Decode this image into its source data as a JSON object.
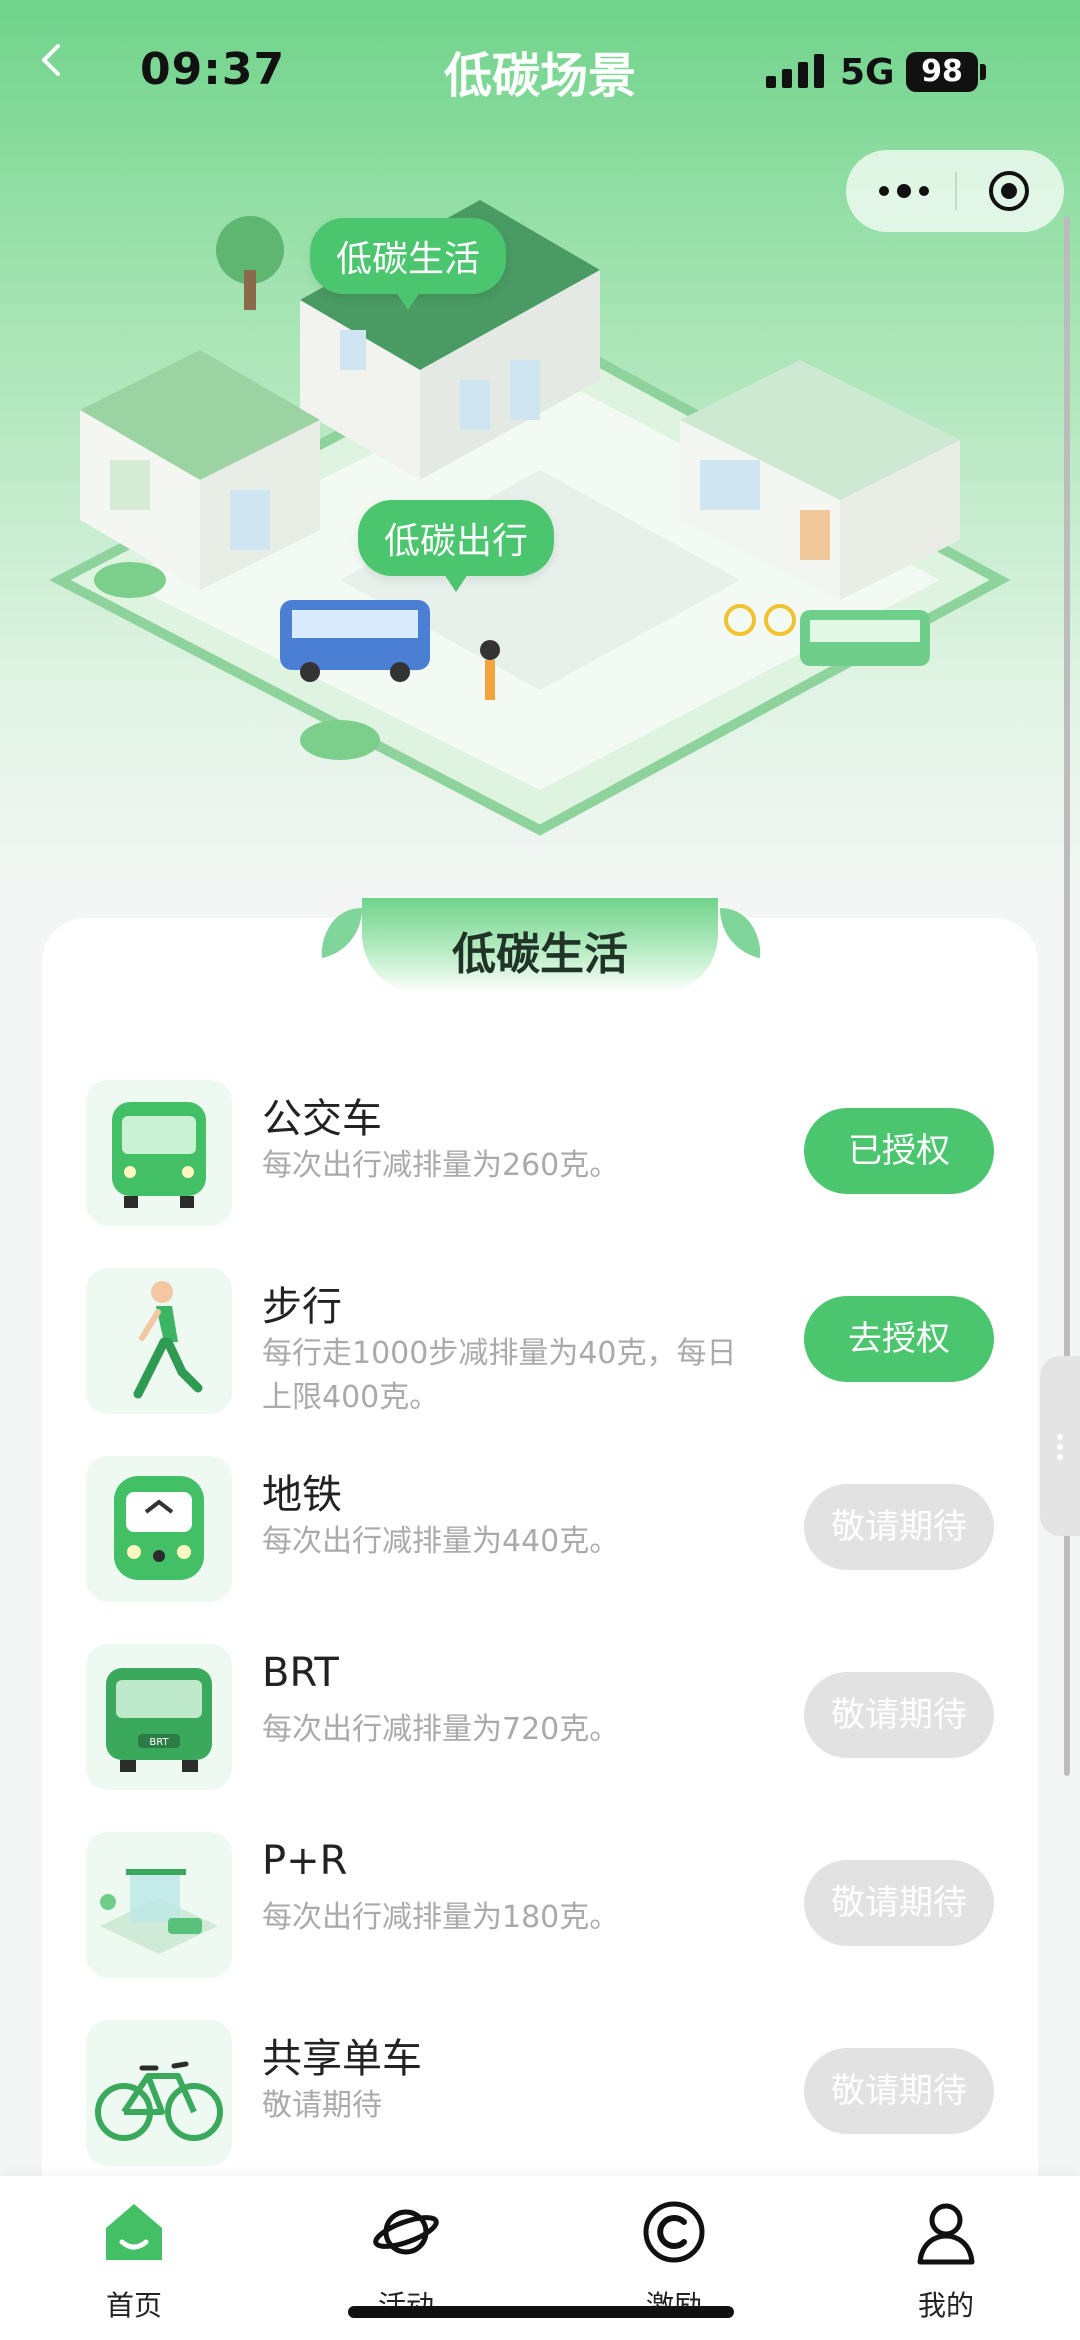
{
  "status_bar": {
    "time": "09:37",
    "network": "5G",
    "battery": "98"
  },
  "header": {
    "title": "低碳场景"
  },
  "scene": {
    "bubble_life": "低碳生活",
    "bubble_travel": "低碳出行"
  },
  "section": {
    "title": "低碳生活"
  },
  "items": [
    {
      "icon": "bus-icon",
      "title": "公交车",
      "desc": "每次出行减排量为260克。",
      "button": "已授权",
      "state": "green"
    },
    {
      "icon": "walking-person-icon",
      "title": "步行",
      "desc": "每行走1000步减排量为40克，每日上限400克。",
      "button": "去授权",
      "state": "green"
    },
    {
      "icon": "subway-icon",
      "title": "地铁",
      "desc": "每次出行减排量为440克。",
      "button": "敬请期待",
      "state": "gray"
    },
    {
      "icon": "brt-bus-icon",
      "title": "BRT",
      "desc": "每次出行减排量为720克。",
      "button": "敬请期待",
      "state": "gray"
    },
    {
      "icon": "park-and-ride-icon",
      "title": "P+R",
      "desc": "每次出行减排量为180克。",
      "button": "敬请期待",
      "state": "gray"
    },
    {
      "icon": "bicycle-icon",
      "title": "共享单车",
      "desc": "敬请期待",
      "button": "敬请期待",
      "state": "gray"
    }
  ],
  "tabbar": {
    "home": "首页",
    "activity": "活动",
    "incentive": "激励",
    "mine": "我的"
  },
  "colors": {
    "accent": "#4cc56f",
    "disabled": "#e2e2e2",
    "desc_text": "#aaaaaa"
  }
}
